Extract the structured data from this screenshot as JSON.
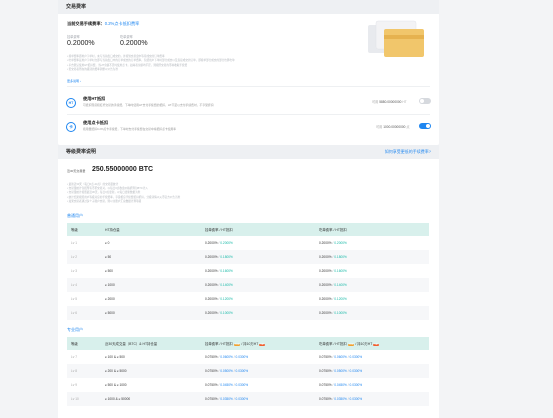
{
  "fee_section": {
    "header": "交易费率",
    "current_label": "当前交易手续费率：",
    "current_value": "0.2%点卡抵扣费率",
    "maker_label": "挂单费率",
    "maker_value": "0.2000%",
    "taker_label": "吃单费率",
    "taker_value": "0.2000%",
    "notes": [
      "• 挂单费率即用户下单时，未与当前盘口成交的，并挂到交易盘中等待成交的订单费率",
      "• 吃单费率是用户下单时立即与当前盘口中的订单成交的订单费率，包括用户下单时部分成交以及直接成交的订单，即挂单部分成交的部分也算吃单",
      "• 平台默认使用HT抵扣费，当HT余额不足时使用点卡，如两者余额均不足，则按所交易的币种收取手续费",
      "• 若交易者所在的级别的费率调整以公告为准"
    ],
    "more_link": "更多说明 ›"
  },
  "options": [
    {
      "icon": "HT",
      "icon_name": "ht-coin-icon",
      "title": "使用HT抵扣",
      "desc": "可抵扣现货和杠杆交易的手续费，下单时使用HT支付手续费的抵扣，HT不足以支付手续费时，不享受折扣",
      "balance_label": "可用",
      "balance_value": "5880.00000000",
      "balance_unit": "HT",
      "enabled": false
    },
    {
      "icon": "卡",
      "icon_name": "point-card-icon",
      "title": "使用点卡抵扣",
      "desc": "按用量抵扣0.2%点卡手续费，下单时支付手续费在交易中将抵扣点卡使用率",
      "balance_label": "可用",
      "balance_value": "1000.00000000",
      "balance_unit": "点",
      "enabled": true
    }
  ],
  "level_section": {
    "header": "等级费率说明",
    "link": "如何享受更低的手续费率?",
    "assets_label": "近30天交易量",
    "assets_value": "250.55000000 BTC",
    "notes": [
      "• 最新近30天（每日0点-24点）的交易量统计",
      "• 交易量统计包括所有币币交易对，以每日0点收盘价格折算为BTC计入",
      "• 交易量统计按照最近30天，每日0点更新，以每日更新数据为准",
      "• 统计结果按照用户等级对应的手续费率，享受相应手续费抵扣折扣，分级详情以火币官方公告为准",
      "• 如果交易者通过多个子账户交易，则以主账户汇总数据计算等级"
    ],
    "normal_group": "普通用户",
    "normal_headers": [
      "等级",
      "HT持仓量",
      "挂单费率 / HT抵扣",
      "吃单费率 / HT抵扣"
    ],
    "normal_rows": [
      {
        "level": "Lv 1",
        "ht": "≥ 0",
        "maker": "0.2000%",
        "maker_ht": "0.2000%",
        "taker": "0.2000%",
        "taker_ht": "0.2000%"
      },
      {
        "level": "Lv 2",
        "ht": "≥ 50",
        "maker": "0.2000%",
        "maker_ht": "0.1800%",
        "taker": "0.2000%",
        "taker_ht": "0.1800%"
      },
      {
        "level": "Lv 3",
        "ht": "≥ 500",
        "maker": "0.2000%",
        "maker_ht": "0.1600%",
        "taker": "0.2000%",
        "taker_ht": "0.1600%"
      },
      {
        "level": "Lv 4",
        "ht": "≥ 1000",
        "maker": "0.2000%",
        "maker_ht": "0.1400%",
        "taker": "0.2000%",
        "taker_ht": "0.1400%"
      },
      {
        "level": "Lv 5",
        "ht": "≥ 2000",
        "maker": "0.2000%",
        "maker_ht": "0.1200%",
        "taker": "0.2000%",
        "taker_ht": "0.1200%"
      },
      {
        "level": "Lv 6",
        "ht": "≥ 5000",
        "maker": "0.2000%",
        "maker_ht": "0.1000%",
        "taker": "0.2000%",
        "taker_ht": "0.1000%"
      }
    ],
    "pro_group": "专业用户",
    "pro_headers": [
      "等级",
      "近30天成交量（BTC）& HT持仓量",
      "挂单费率",
      "/ HT抵扣",
      "/ 持10万HT",
      "吃单费率",
      "/ HT抵扣",
      "/ 持10万HT"
    ],
    "pro_tags": [
      "TOP",
      "VIP"
    ],
    "pro_rows": [
      {
        "level": "Lv 7",
        "cond": "≥ 100 & ≥ 500",
        "maker": "0.0750%",
        "maker_ht": "0.0600%",
        "maker_vip": "0.0300%",
        "taker": "0.0750%",
        "taker_ht": "0.0600%",
        "taker_vip": "0.0300%"
      },
      {
        "level": "Lv 8",
        "cond": "≥ 200 & ≥ 5000",
        "maker": "0.0750%",
        "maker_ht": "0.0500%",
        "maker_vip": "0.0300%",
        "taker": "0.0750%",
        "taker_ht": "0.0500%",
        "taker_vip": "0.0300%"
      },
      {
        "level": "Lv 9",
        "cond": "≥ 500 & ≥ 1000",
        "maker": "0.0750%",
        "maker_ht": "0.0450%",
        "maker_vip": "0.0300%",
        "taker": "0.0750%",
        "taker_ht": "0.0450%",
        "taker_vip": "0.0300%"
      },
      {
        "level": "Lv 10",
        "cond": "≥ 1000 & ≥ 50000",
        "maker": "0.0750%",
        "maker_ht": "0.0350%",
        "maker_vip": "0.0300%",
        "taker": "0.0750%",
        "taker_ht": "0.0350%",
        "taker_vip": "0.0300%"
      }
    ]
  },
  "colors": {
    "accent": "#1e86f0",
    "green": "#15b8a6",
    "table_head": "#d8f0ec"
  }
}
